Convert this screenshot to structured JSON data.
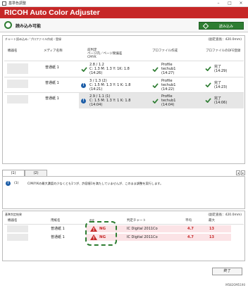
{
  "window": {
    "title": "基準色調整"
  },
  "app": {
    "brand": "RICOH Auto Color Adjuster"
  },
  "status": {
    "text": "読み込み可能",
    "read_button": "読み込み"
  },
  "chart_panel": {
    "title": "チャート読み込み／プロファイル作成・登録",
    "density": "(副走査長：420.0mm)",
    "headers": {
      "machine": "機器名",
      "media": "メディア名称",
      "prev": "前判定\nページ内／ページ間偏差\nCMYK",
      "profile": "プロファイル作成",
      "register": "プロファイルのDFE登録"
    },
    "rows": [
      {
        "media": "普通紙 1",
        "status": "ok",
        "ratio": "2.8 / 1.2",
        "cmyk": "C: 1.3 M: 1.3 Y: 1K: 1.8",
        "time": "(14:26)",
        "profile": "Profile",
        "profile_name": "techub1",
        "profile_time": "(14:27)",
        "reg": "完了",
        "reg_time": "(14:29)"
      },
      {
        "media": "普通紙 1",
        "status": "info",
        "ratio": "3 / 1.3    (2)",
        "cmyk": "C: 1.5 M: 1.3 Y: 1 K: 1.8",
        "time": "(14:21)",
        "profile": "Profile",
        "profile_name": "techub1",
        "profile_time": "(14:22)",
        "reg": "完了",
        "reg_time": "(14:23)"
      },
      {
        "media": "普通紙 1",
        "status": "info",
        "ratio": "2.9 / 1.1    (1)",
        "cmyk": "C: 1.5 M: 1.3 Y: 1 K: 1.8",
        "time": "(14:04)",
        "profile": "Profile",
        "profile_name": "techub1",
        "profile_time": "(14:04)",
        "reg": "完了",
        "reg_time": "(14:06)"
      }
    ]
  },
  "tabs": [
    "(1)",
    "(2)"
  ],
  "message": {
    "num": "(1)",
    "text": "C/M/Y/Kの最大濃度の少なくとも1つが、許容値1を満たしていませんが、このまま調整を実行します。"
  },
  "judge_panel": {
    "title": "基準判定結果",
    "density": "(副走査長：420.0mm)",
    "headers": {
      "machine": "機器名",
      "paper": "用紙名",
      "result": "判定",
      "chart": "判定チャート",
      "avg": "平均",
      "max": "最大"
    },
    "rows": [
      {
        "paper": "普通紙 1",
        "result": "NG",
        "chart": "IC Digital 2011Co",
        "avg": "4.7",
        "max": "13"
      },
      {
        "paper": "普通紙 1",
        "result": "NG",
        "chart": "IC Digital 2011Co",
        "avg": "4.7",
        "max": "13"
      }
    ]
  },
  "buttons": {
    "close": "終了"
  },
  "footer_code": "M582OM5190",
  "colors": {
    "brand_red": "#c62828",
    "ok_green": "#2e7d32",
    "info_blue": "#1f5fa8",
    "ng_row": "#fbe3e6"
  }
}
